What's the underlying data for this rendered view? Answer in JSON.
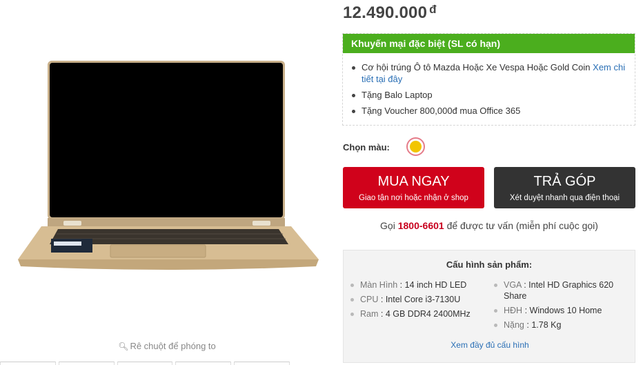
{
  "product": {
    "image_alt": "laptop",
    "zoom_hint": "Rê chuột để phóng to",
    "zoom_icon": "magnifier-icon"
  },
  "price": {
    "amount": "12.490.000",
    "currency": "đ"
  },
  "promo": {
    "title": "Khuyến mại đặc biệt (SL có hạn)",
    "items": [
      {
        "text": "Cơ hội trúng Ô tô Mazda Hoặc Xe Vespa Hoặc Gold Coin ",
        "link": "Xem chi tiết tại đây"
      },
      {
        "text": "Tặng Balo Laptop"
      },
      {
        "text": "Tặng Voucher 800,000đ mua Office 365"
      }
    ]
  },
  "color_picker": {
    "label": "Chọn màu:",
    "selected_color": "#f2c500"
  },
  "buttons": {
    "buy_title": "MUA NGAY",
    "buy_sub": "Giao tận nơi hoặc nhận ở shop",
    "installment_title": "TRẢ GÓP",
    "installment_sub": "Xét duyệt nhanh qua điện thoại"
  },
  "hotline": {
    "prefix": "Gọi",
    "phone": "1800-6601",
    "suffix": "để được tư vấn (miễn phí cuộc gọi)"
  },
  "specs": {
    "title": "Cấu hình sản phẩm:",
    "left": [
      {
        "key": "Màn Hình",
        "value": "14 inch HD LED"
      },
      {
        "key": "CPU",
        "value": "Intel Core i3-7130U"
      },
      {
        "key": "Ram",
        "value": "4 GB DDR4 2400MHz"
      }
    ],
    "right": [
      {
        "key": "VGA",
        "value": "Intel HD Graphics 620 Share"
      },
      {
        "key": "HĐH",
        "value": "Windows 10 Home"
      },
      {
        "key": "Nặng",
        "value": "1.78 Kg"
      }
    ],
    "more_link": "Xem đầy đủ cấu hình"
  },
  "colors": {
    "promo_green": "#4bae1e",
    "buy_red": "#d0021b",
    "installment_dark": "#333333",
    "link_blue": "#2a6fb5"
  }
}
